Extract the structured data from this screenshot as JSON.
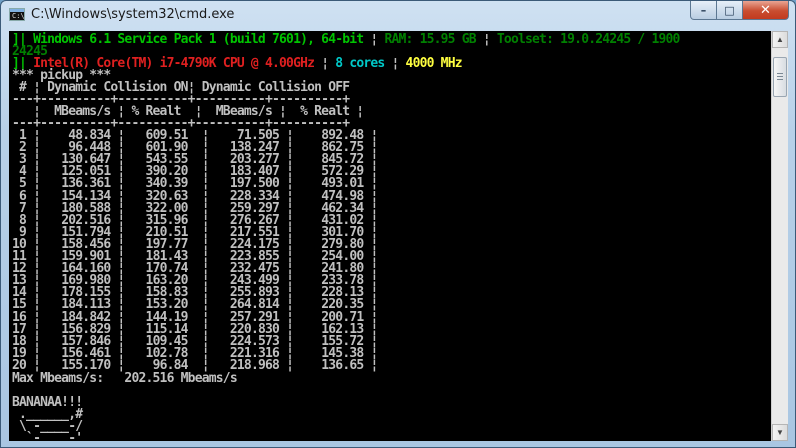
{
  "window": {
    "title": "C:\\Windows\\system32\\cmd.exe",
    "min_label": "–",
    "max_label": "□",
    "close_label": "✕"
  },
  "console": {
    "header_os": "]| Windows 6.1 Service Pack 1 (build 7601), 64-bit",
    "header_ram": "RAM: 15.95 GB",
    "header_toolset": "Toolset: 19.0.24245 / 1900",
    "header_toolset_cont": "24245",
    "cpu_prefix": "]| ",
    "cpu_name": "Intel(R) Core(TM) i7-4790K CPU @ 4.00GHz",
    "cpu_cores": "8 cores",
    "cpu_freq": "4000 MHz",
    "test_name": "*** pickup ***",
    "table_header_1": " # ¦ Dynamic Collision ON¦ Dynamic Collision OFF",
    "table_sep_1": "---+----------+----------+----------+----------+",
    "table_header_2": "   ¦  MBeams/s ¦ % Realt  ¦  MBeams/s ¦  % Realt ¦",
    "table_sep_2": "---+----------+----------+----------+----------+",
    "rows": [
      [
        " 1",
        "48.834",
        "609.51",
        "71.505",
        "892.48"
      ],
      [
        " 2",
        "96.448",
        "601.90",
        "138.247",
        "862.75"
      ],
      [
        " 3",
        "130.647",
        "543.55",
        "203.277",
        "845.72"
      ],
      [
        " 4",
        "125.051",
        "390.20",
        "183.407",
        "572.29"
      ],
      [
        " 5",
        "136.361",
        "340.39",
        "197.500",
        "493.01"
      ],
      [
        " 6",
        "154.134",
        "320.63",
        "228.334",
        "474.98"
      ],
      [
        " 7",
        "180.588",
        "322.00",
        "259.297",
        "462.34"
      ],
      [
        " 8",
        "202.516",
        "315.96",
        "276.267",
        "431.02"
      ],
      [
        " 9",
        "151.794",
        "210.51",
        "217.551",
        "301.70"
      ],
      [
        "10",
        "158.456",
        "197.77",
        "224.175",
        "279.80"
      ],
      [
        "11",
        "159.901",
        "181.43",
        "223.855",
        "254.00"
      ],
      [
        "12",
        "164.160",
        "170.74",
        "232.475",
        "241.80"
      ],
      [
        "13",
        "169.980",
        "163.20",
        "243.499",
        "233.78"
      ],
      [
        "14",
        "178.155",
        "158.83",
        "255.893",
        "228.13"
      ],
      [
        "15",
        "184.113",
        "153.20",
        "264.814",
        "220.35"
      ],
      [
        "16",
        "184.842",
        "144.19",
        "257.291",
        "200.71"
      ],
      [
        "17",
        "156.829",
        "115.14",
        "220.830",
        "162.13"
      ],
      [
        "18",
        "157.846",
        "109.45",
        "224.573",
        "155.72"
      ],
      [
        "19",
        "156.461",
        "102.78",
        "221.316",
        "145.38"
      ],
      [
        "20",
        "155.170",
        "96.84",
        "218.968",
        "136.65"
      ]
    ],
    "max_line": "Max Mbeams/s:   202.516 Mbeams/s",
    "banana": "BANANAA!!!",
    "art_1": " .______,#",
    "art_2": " \\ -____-/",
    "art_3": "  `-____-'",
    "colors": {
      "green": "#00c400",
      "dark_green": "#008000",
      "red": "#e02020",
      "cyan": "#00c8c8",
      "yellow": "#ffff40",
      "gray": "#c0c0c0"
    }
  },
  "scrollbar": {
    "up_icon": "▲",
    "down_icon": "▼"
  }
}
